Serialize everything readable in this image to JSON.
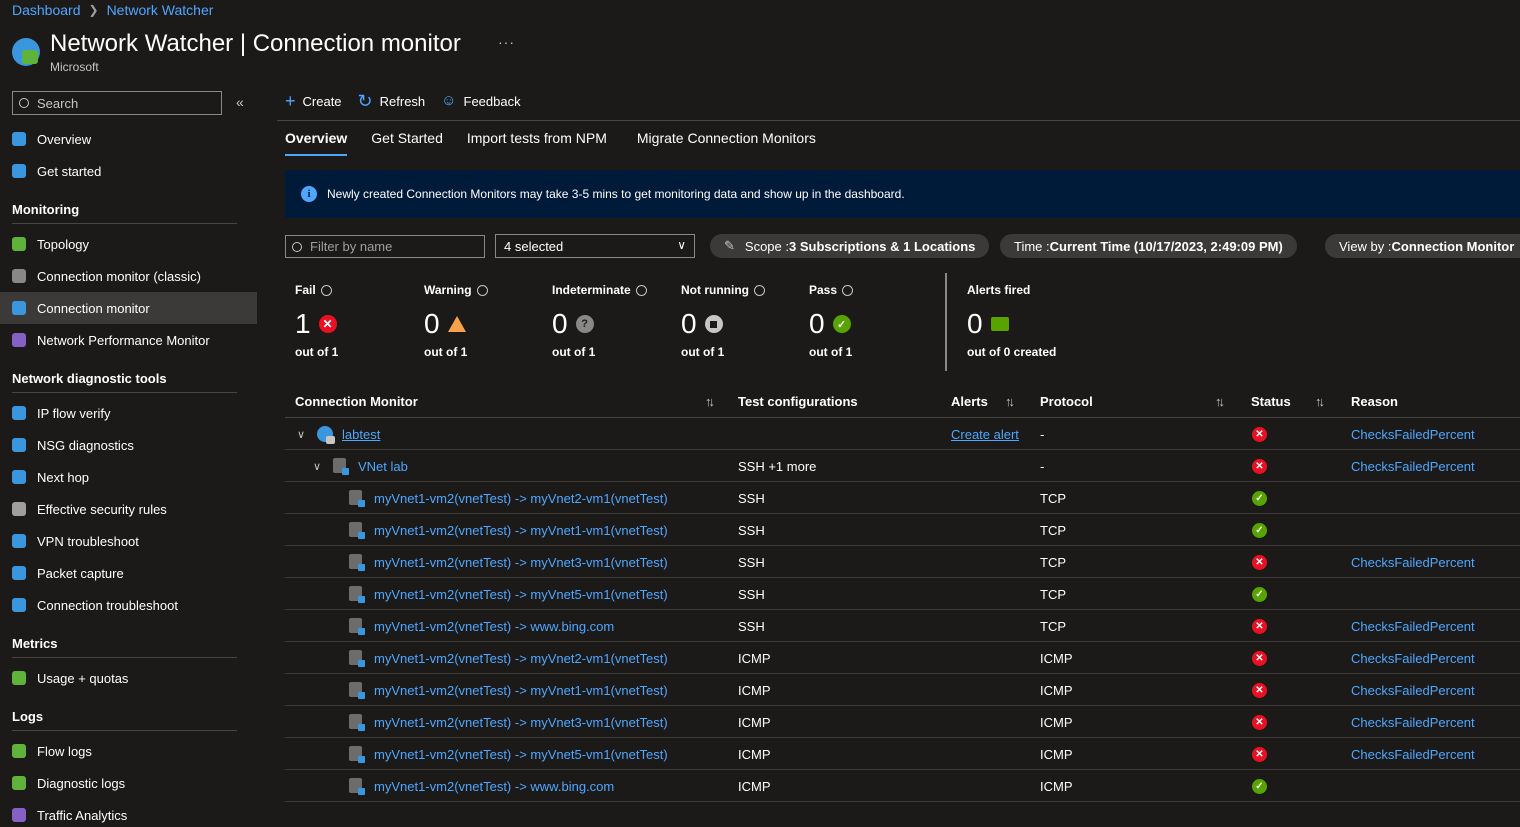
{
  "breadcrumb": [
    "Dashboard",
    "Network Watcher"
  ],
  "header": {
    "title_main": "Network Watcher",
    "title_rest": " | Connection monitor",
    "subtitle": "Microsoft",
    "more": "···"
  },
  "sidebar": {
    "search_placeholder": "Search",
    "collapse": "«",
    "top_items": [
      {
        "label": "Overview",
        "icon": "globe-icon",
        "color": "#3a96dd"
      },
      {
        "label": "Get started",
        "icon": "cloud-icon",
        "color": "#3a96dd"
      }
    ],
    "sections": [
      {
        "title": "Monitoring",
        "items": [
          {
            "label": "Topology",
            "icon": "topology-icon",
            "color": "#5fb33a"
          },
          {
            "label": "Connection monitor (classic)",
            "icon": "monitor-icon",
            "color": "#8a8886"
          },
          {
            "label": "Connection monitor",
            "icon": "connection-monitor-icon",
            "color": "#3a96dd",
            "active": true
          },
          {
            "label": "Network Performance Monitor",
            "icon": "npm-icon",
            "color": "#8661c5"
          }
        ]
      },
      {
        "title": "Network diagnostic tools",
        "items": [
          {
            "label": "IP flow verify",
            "icon": "ip-flow-icon",
            "color": "#3a96dd"
          },
          {
            "label": "NSG diagnostics",
            "icon": "nsg-icon",
            "color": "#3a96dd"
          },
          {
            "label": "Next hop",
            "icon": "next-hop-icon",
            "color": "#3a96dd"
          },
          {
            "label": "Effective security rules",
            "icon": "security-rules-icon",
            "color": "#a19f9d"
          },
          {
            "label": "VPN troubleshoot",
            "icon": "vpn-icon",
            "color": "#3a96dd"
          },
          {
            "label": "Packet capture",
            "icon": "packet-capture-icon",
            "color": "#3a96dd"
          },
          {
            "label": "Connection troubleshoot",
            "icon": "troubleshoot-icon",
            "color": "#3a96dd"
          }
        ]
      },
      {
        "title": "Metrics",
        "items": [
          {
            "label": "Usage + quotas",
            "icon": "usage-icon",
            "color": "#5fb33a"
          }
        ]
      },
      {
        "title": "Logs",
        "items": [
          {
            "label": "Flow logs",
            "icon": "flow-logs-icon",
            "color": "#5fb33a"
          },
          {
            "label": "Diagnostic logs",
            "icon": "diagnostic-logs-icon",
            "color": "#5fb33a"
          },
          {
            "label": "Traffic Analytics",
            "icon": "traffic-analytics-icon",
            "color": "#8661c5"
          }
        ]
      }
    ]
  },
  "toolbar": {
    "create": "Create",
    "refresh": "Refresh",
    "feedback": "Feedback"
  },
  "tabs": [
    "Overview",
    "Get Started",
    "Import tests from NPM",
    "Migrate Connection Monitors"
  ],
  "banner": {
    "text": "Newly created Connection Monitors may take 3-5 mins to get monitoring data and show up in the dashboard."
  },
  "filters": {
    "name_placeholder": "Filter by name",
    "select_value": "4 selected",
    "scope_label": "Scope : ",
    "scope_value": "3 Subscriptions & 1 Locations",
    "time_label": "Time : ",
    "time_value": "Current Time (10/17/2023, 2:49:09 PM)",
    "view_label": "View by : ",
    "view_value": "Connection Monitor"
  },
  "summary": [
    {
      "label": "Fail",
      "count": "1",
      "sub": "out of 1",
      "status": "fail"
    },
    {
      "label": "Warning",
      "count": "0",
      "sub": "out of 1",
      "status": "warning"
    },
    {
      "label": "Indeterminate",
      "count": "0",
      "sub": "out of 1",
      "status": "indeterminate"
    },
    {
      "label": "Not running",
      "count": "0",
      "sub": "out of 1",
      "status": "not-running"
    },
    {
      "label": "Pass",
      "count": "0",
      "sub": "out of 1",
      "status": "pass"
    }
  ],
  "alerts_fired": {
    "label": "Alerts fired",
    "count": "0",
    "sub": "out of 0 created"
  },
  "table": {
    "headers": {
      "monitor": "Connection Monitor",
      "tests": "Test configurations",
      "alerts": "Alerts",
      "protocol": "Protocol",
      "status": "Status",
      "reason": "Reason"
    },
    "monitor_row": {
      "name": "labtest",
      "alerts": "Create alert",
      "protocol": "-",
      "status": "fail",
      "reason": "ChecksFailedPercent"
    },
    "group_row": {
      "name": "VNet lab",
      "tests": "SSH +1 more",
      "protocol": "-",
      "status": "fail",
      "reason": "ChecksFailedPercent"
    },
    "rows": [
      {
        "name": "myVnet1-vm2(vnetTest) -> myVnet2-vm1(vnetTest)",
        "tests": "SSH",
        "protocol": "TCP",
        "status": "pass",
        "reason": ""
      },
      {
        "name": "myVnet1-vm2(vnetTest) -> myVnet1-vm1(vnetTest)",
        "tests": "SSH",
        "protocol": "TCP",
        "status": "pass",
        "reason": ""
      },
      {
        "name": "myVnet1-vm2(vnetTest) -> myVnet3-vm1(vnetTest)",
        "tests": "SSH",
        "protocol": "TCP",
        "status": "fail",
        "reason": "ChecksFailedPercent"
      },
      {
        "name": "myVnet1-vm2(vnetTest) -> myVnet5-vm1(vnetTest)",
        "tests": "SSH",
        "protocol": "TCP",
        "status": "pass",
        "reason": ""
      },
      {
        "name": "myVnet1-vm2(vnetTest) -> www.bing.com",
        "tests": "SSH",
        "protocol": "TCP",
        "status": "fail",
        "reason": "ChecksFailedPercent"
      },
      {
        "name": "myVnet1-vm2(vnetTest) -> myVnet2-vm1(vnetTest)",
        "tests": "ICMP",
        "protocol": "ICMP",
        "status": "fail",
        "reason": "ChecksFailedPercent"
      },
      {
        "name": "myVnet1-vm2(vnetTest) -> myVnet1-vm1(vnetTest)",
        "tests": "ICMP",
        "protocol": "ICMP",
        "status": "fail",
        "reason": "ChecksFailedPercent"
      },
      {
        "name": "myVnet1-vm2(vnetTest) -> myVnet3-vm1(vnetTest)",
        "tests": "ICMP",
        "protocol": "ICMP",
        "status": "fail",
        "reason": "ChecksFailedPercent"
      },
      {
        "name": "myVnet1-vm2(vnetTest) -> myVnet5-vm1(vnetTest)",
        "tests": "ICMP",
        "protocol": "ICMP",
        "status": "fail",
        "reason": "ChecksFailedPercent"
      },
      {
        "name": "myVnet1-vm2(vnetTest) -> www.bing.com",
        "tests": "ICMP",
        "protocol": "ICMP",
        "status": "pass",
        "reason": ""
      }
    ]
  },
  "colors": {
    "fail": "#e81123",
    "pass": "#57a300",
    "warning": "#f7a24b",
    "accent": "#4fa6ff",
    "banner": "#001a3a"
  }
}
